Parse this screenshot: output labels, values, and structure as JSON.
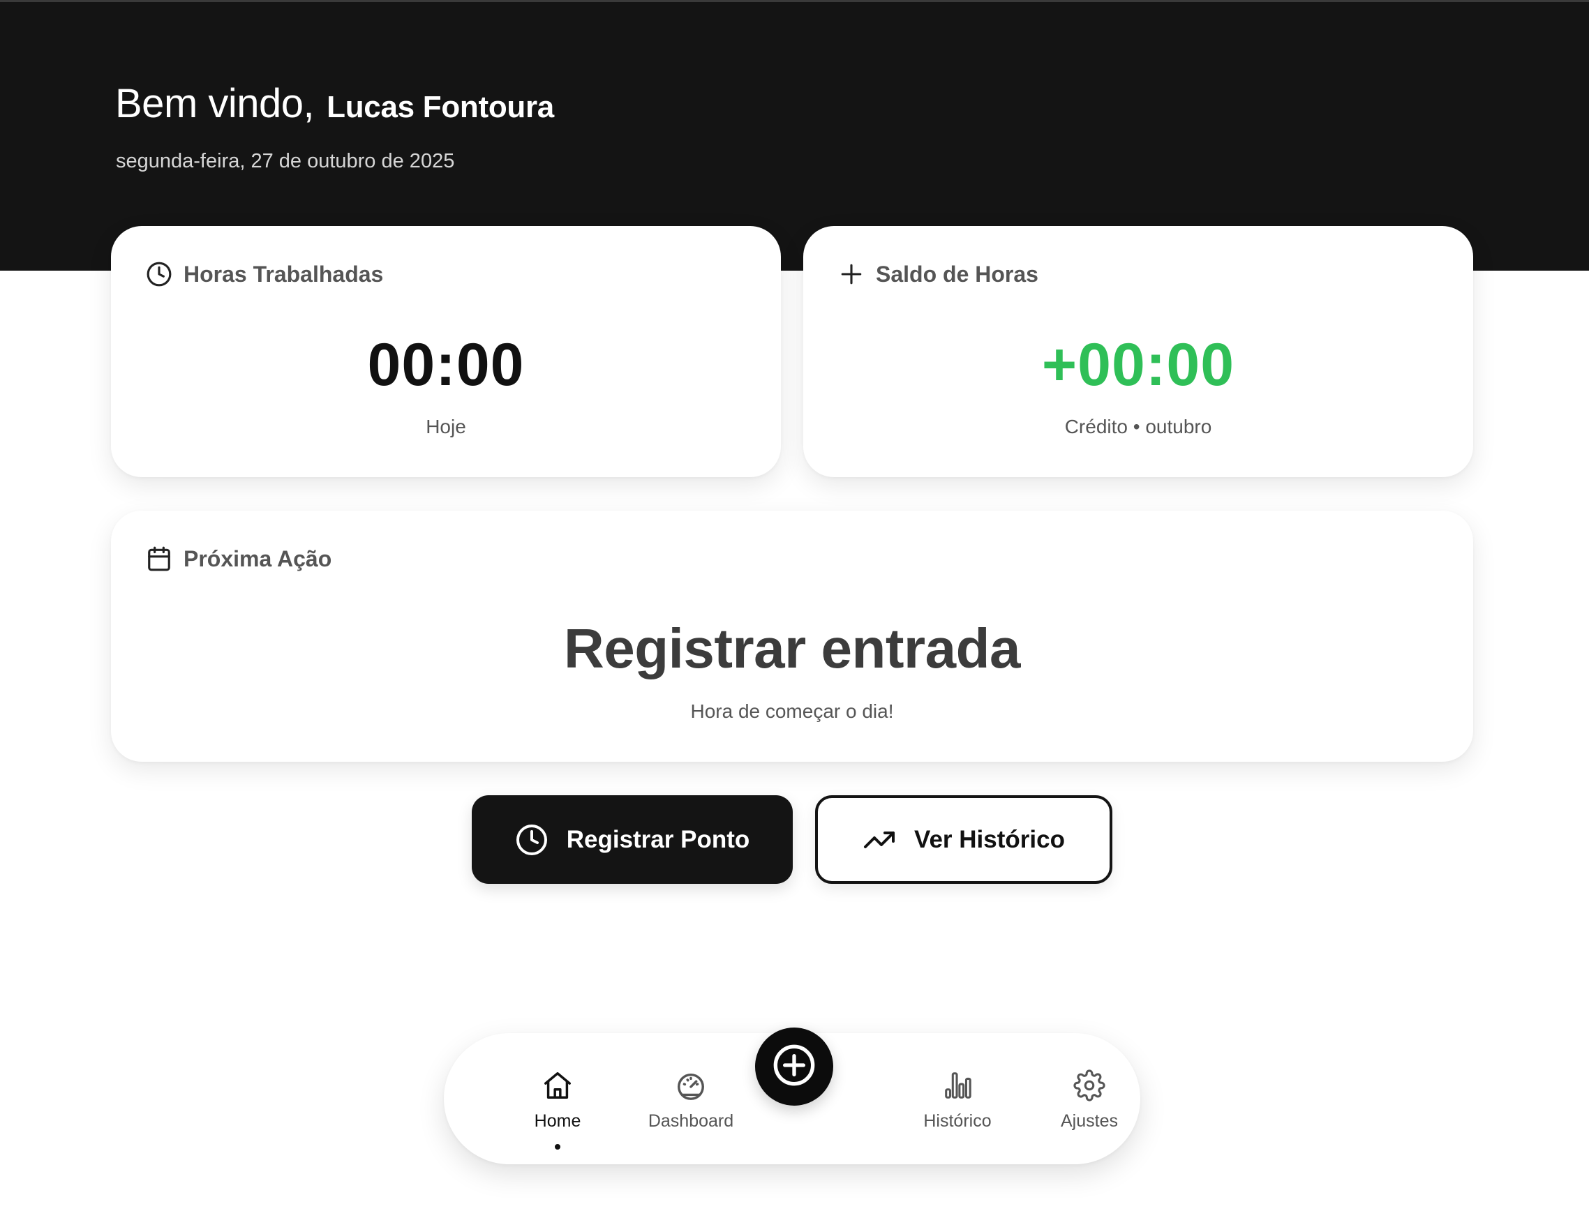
{
  "header": {
    "greeting": "Bem vindo,",
    "user_name": "Lucas Fontoura",
    "date": "segunda-feira, 27 de outubro de 2025"
  },
  "cards": {
    "hours_worked": {
      "icon": "clock-icon",
      "title": "Horas Trabalhadas",
      "value": "00:00",
      "caption": "Hoje"
    },
    "balance": {
      "icon": "plus-icon",
      "title": "Saldo de Horas",
      "value": "+00:00",
      "caption": "Crédito • outubro",
      "value_color": "#2fbf57"
    },
    "next_action": {
      "icon": "calendar-icon",
      "title": "Próxima Ação",
      "action": "Registrar entrada",
      "message": "Hora de começar o dia!"
    }
  },
  "actions": {
    "register": {
      "label": "Registrar Ponto",
      "icon": "clock-icon"
    },
    "history": {
      "label": "Ver Histórico",
      "icon": "trending-up-icon"
    }
  },
  "bottom_nav": {
    "items": [
      {
        "label": "Home",
        "icon": "home-icon",
        "active": true
      },
      {
        "label": "Dashboard",
        "icon": "gauge-icon",
        "active": false
      },
      {
        "label": "Histórico",
        "icon": "bar-chart-icon",
        "active": false
      },
      {
        "label": "Ajustes",
        "icon": "gear-icon",
        "active": false
      }
    ],
    "fab_icon": "plus-circle-icon"
  },
  "colors": {
    "header_bg": "#141414",
    "accent_green": "#2fbf57",
    "primary_button": "#141414"
  }
}
